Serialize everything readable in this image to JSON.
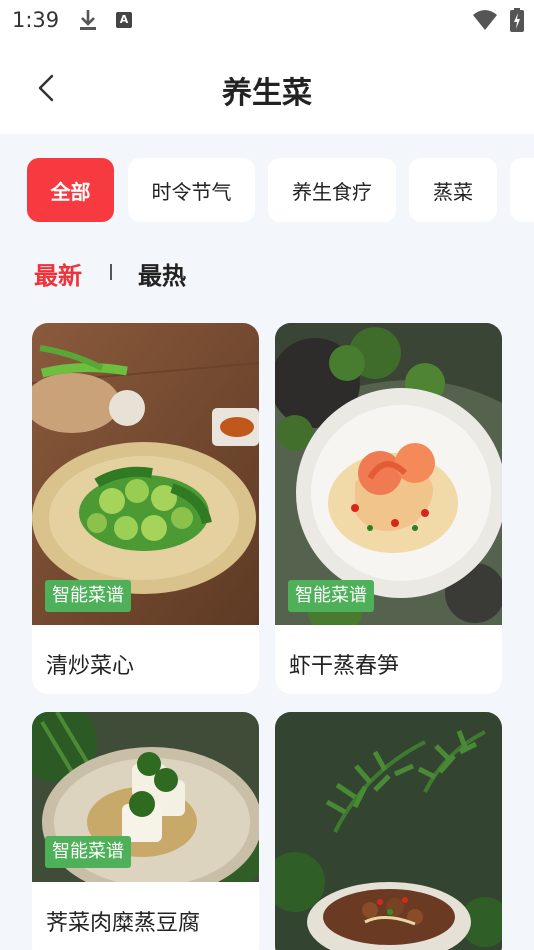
{
  "status_bar": {
    "time": "1:39",
    "icons": [
      "download-icon",
      "a-icon",
      "wifi-icon",
      "battery-icon"
    ]
  },
  "header": {
    "title": "养生菜",
    "back_icon": "chevron-left-icon"
  },
  "categories": [
    {
      "label": "全部",
      "active": true
    },
    {
      "label": "时令节气",
      "active": false
    },
    {
      "label": "养生食疗",
      "active": false
    },
    {
      "label": "蒸菜",
      "active": false
    }
  ],
  "sort": {
    "newest": "最新",
    "hot": "最热",
    "active": "newest"
  },
  "recipes": [
    {
      "title": "清炒菜心",
      "badge": "智能菜谱"
    },
    {
      "title": "虾干蒸春笋",
      "badge": "智能菜谱"
    },
    {
      "title": "荠菜肉糜蒸豆腐",
      "badge": "智能菜谱"
    },
    {
      "title": "",
      "badge": ""
    }
  ],
  "colors": {
    "accent": "#f73a3f",
    "badge": "#4fb05a",
    "background": "#f3f6fa"
  }
}
